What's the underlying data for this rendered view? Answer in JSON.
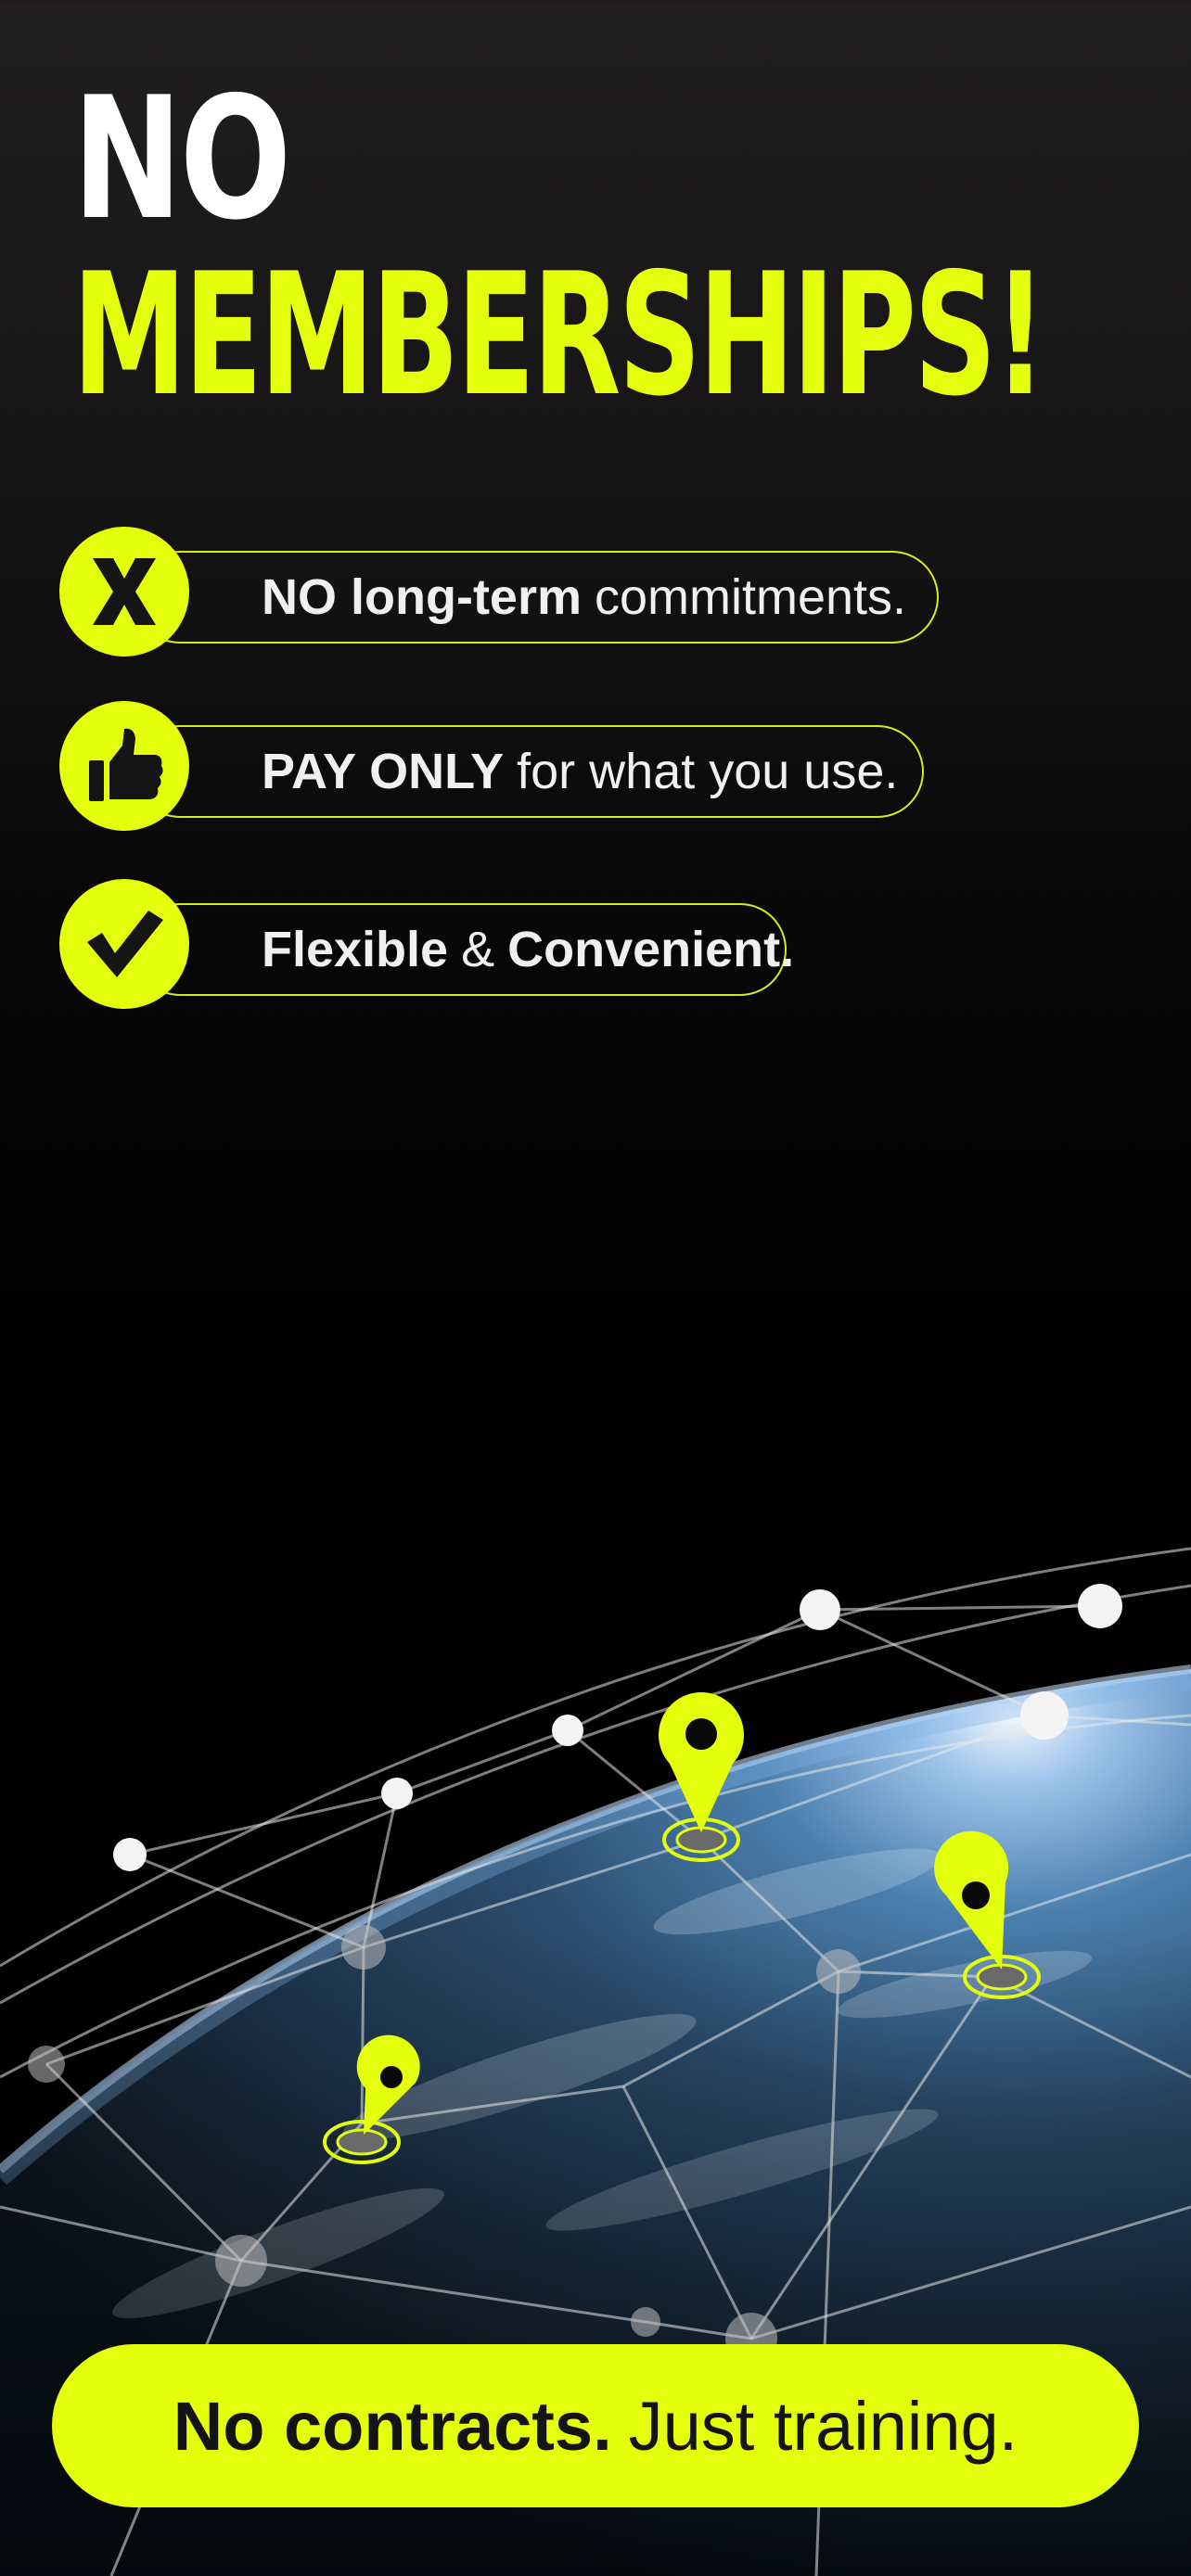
{
  "headline": {
    "line1": "NO",
    "line2": "MEMBERSHIPS!"
  },
  "features": [
    {
      "icon": "x-icon",
      "bold": "NO long-term",
      "rest": "commitments."
    },
    {
      "icon": "thumbs-up-icon",
      "bold": "PAY ONLY",
      "rest": "for what you use."
    },
    {
      "icon": "checkmark-icon",
      "bold": "Flexible",
      "middle": "&",
      "bold2": "Convenient."
    }
  ],
  "cta": {
    "bold": "No contracts.",
    "rest": "Just training."
  },
  "colors": {
    "accent": "#e3ff0c",
    "background": "#000000",
    "text": "#ffffff"
  }
}
